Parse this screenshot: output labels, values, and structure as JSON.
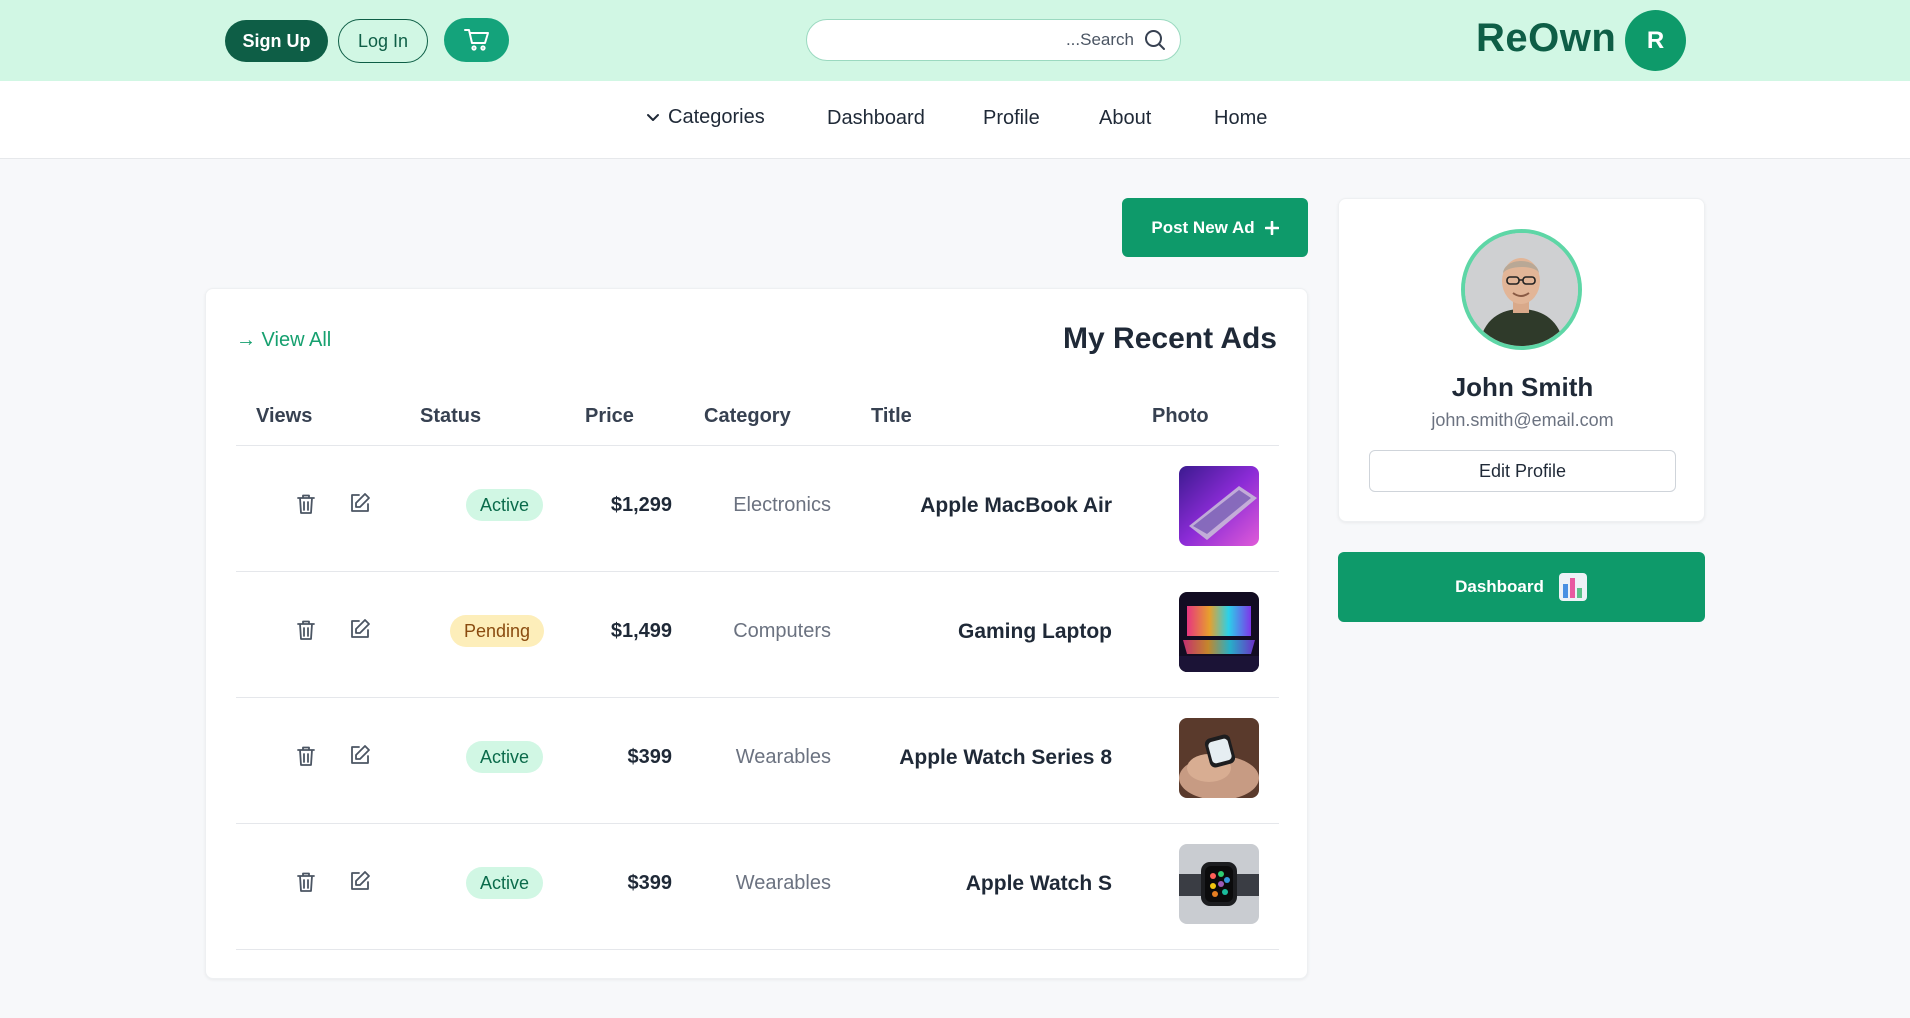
{
  "header": {
    "signup_label": "Sign Up",
    "login_label": "Log In",
    "cart_icon": "cart-icon",
    "search_placeholder": "...Search",
    "brand": "ReOwn",
    "user_initial": "R"
  },
  "nav": {
    "categories": "Categories",
    "dashboard": "Dashboard",
    "profile": "Profile",
    "about": "About",
    "home": "Home"
  },
  "post_button": "Post New Ad",
  "ads": {
    "view_all": "→ View All",
    "title": "My Recent Ads",
    "columns": {
      "views": "Views",
      "status": "Status",
      "price": "Price",
      "category": "Category",
      "title": "Title",
      "photo": "Photo"
    },
    "rows": [
      {
        "status": "Active",
        "status_type": "active",
        "price": "$1,299",
        "category": "Electronics",
        "title": "Apple MacBook Air"
      },
      {
        "status": "Pending",
        "status_type": "pending",
        "price": "$1,499",
        "category": "Computers",
        "title": "Gaming Laptop"
      },
      {
        "status": "Active",
        "status_type": "active",
        "price": "$399",
        "category": "Wearables",
        "title": "Apple Watch Series 8"
      },
      {
        "status": "Active",
        "status_type": "active",
        "price": "$399",
        "category": "Wearables",
        "title": "Apple Watch S"
      }
    ]
  },
  "profile": {
    "name": "John Smith",
    "email": "john.smith@email.com",
    "edit_label": "Edit Profile"
  },
  "dashboard_button": "Dashboard",
  "colors": {
    "brand_dark": "#0e5e46",
    "brand": "#0e9a6a",
    "header_bg": "#d1f7e4"
  }
}
